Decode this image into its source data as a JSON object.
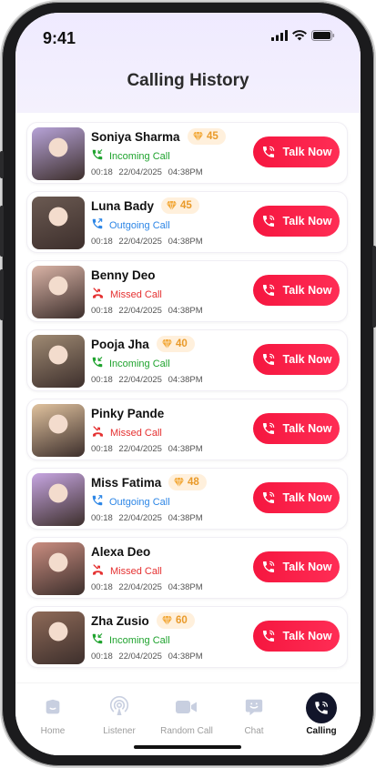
{
  "status": {
    "time": "9:41"
  },
  "header": {
    "title": "Calling History"
  },
  "colors": {
    "accent": "#f5163f",
    "incoming": "#1fa32e",
    "outgoing": "#2d86e6",
    "missed": "#e53030",
    "gem": "#e99a2a"
  },
  "calls": [
    {
      "name": "Soniya Sharma",
      "gems": "45",
      "type": "incoming",
      "type_label": "Incoming Call",
      "duration": "00:18",
      "date": "22/04/2025",
      "time": "04:38PM",
      "action": "Talk Now",
      "avatar_tone": "#b7a3d8"
    },
    {
      "name": "Luna Bady",
      "gems": "45",
      "type": "outgoing",
      "type_label": "Outgoing Call",
      "duration": "00:18",
      "date": "22/04/2025",
      "time": "04:38PM",
      "action": "Talk Now",
      "avatar_tone": "#6b5a52"
    },
    {
      "name": "Benny Deo",
      "gems": "",
      "type": "missed",
      "type_label": "Missed Call",
      "duration": "00:18",
      "date": "22/04/2025",
      "time": "04:38PM",
      "action": "Talk Now",
      "avatar_tone": "#d9b3a6"
    },
    {
      "name": "Pooja Jha",
      "gems": "40",
      "type": "incoming",
      "type_label": "Incoming Call",
      "duration": "00:18",
      "date": "22/04/2025",
      "time": "04:38PM",
      "action": "Talk Now",
      "avatar_tone": "#9f8a73"
    },
    {
      "name": "Pinky Pande",
      "gems": "",
      "type": "missed",
      "type_label": "Missed Call",
      "duration": "00:18",
      "date": "22/04/2025",
      "time": "04:38PM",
      "action": "Talk Now",
      "avatar_tone": "#e0c29e"
    },
    {
      "name": "Miss Fatima",
      "gems": "48",
      "type": "outgoing",
      "type_label": "Outgoing Call",
      "duration": "00:18",
      "date": "22/04/2025",
      "time": "04:38PM",
      "action": "Talk Now",
      "avatar_tone": "#c7a6e2"
    },
    {
      "name": "Alexa Deo",
      "gems": "",
      "type": "missed",
      "type_label": "Missed Call",
      "duration": "00:18",
      "date": "22/04/2025",
      "time": "04:38PM",
      "action": "Talk Now",
      "avatar_tone": "#c98d80"
    },
    {
      "name": "Zha Zusio",
      "gems": "60",
      "type": "incoming",
      "type_label": "Incoming Call",
      "duration": "00:18",
      "date": "22/04/2025",
      "time": "04:38PM",
      "action": "Talk Now",
      "avatar_tone": "#8e6a58"
    }
  ],
  "nav": [
    {
      "label": "Home",
      "icon": "home-icon",
      "active": false
    },
    {
      "label": "Listener",
      "icon": "listener-icon",
      "active": false
    },
    {
      "label": "Random Call",
      "icon": "video-camera-icon",
      "active": false
    },
    {
      "label": "Chat",
      "icon": "chat-icon",
      "active": false
    },
    {
      "label": "Calling",
      "icon": "phone-call-icon",
      "active": true
    }
  ]
}
